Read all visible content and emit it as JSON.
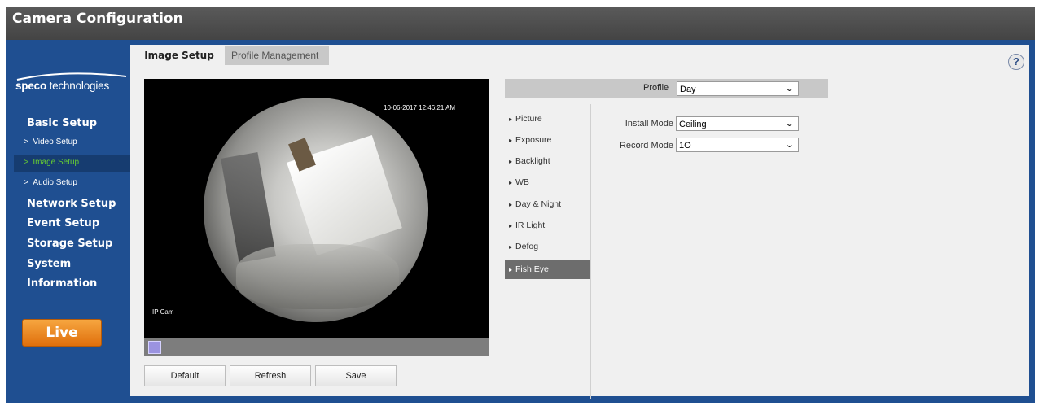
{
  "window": {
    "title": "Camera Configuration"
  },
  "logo": {
    "text_bold": "speco",
    "text_rest": " technologies"
  },
  "sidebar": {
    "sections": [
      {
        "label": "Basic Setup"
      },
      {
        "label": "Network Setup"
      },
      {
        "label": "Event Setup"
      },
      {
        "label": "Storage Setup"
      },
      {
        "label": "System"
      },
      {
        "label": "Information"
      }
    ],
    "sub_items": [
      {
        "label": "Video Setup"
      },
      {
        "label": "Image Setup"
      },
      {
        "label": "Audio Setup"
      }
    ],
    "sub_prefix": ">",
    "live_label": "Live"
  },
  "tabs": [
    {
      "label": "Image Setup"
    },
    {
      "label": "Profile Management"
    }
  ],
  "help": {
    "label": "?"
  },
  "video": {
    "timestamp": "10-06-2017 12:46:21 AM",
    "channel_name": "IP Cam"
  },
  "buttons": {
    "default": "Default",
    "refresh": "Refresh",
    "save": "Save"
  },
  "profile": {
    "label": "Profile",
    "value": "Day"
  },
  "menu": {
    "arrow": "▸",
    "items": [
      {
        "label": "Picture"
      },
      {
        "label": "Exposure"
      },
      {
        "label": "Backlight"
      },
      {
        "label": "WB"
      },
      {
        "label": "Day & Night"
      },
      {
        "label": "IR Light"
      },
      {
        "label": "Defog"
      },
      {
        "label": "Fish Eye"
      }
    ]
  },
  "fisheye": {
    "install_mode_label": "Install Mode",
    "install_mode_value": "Ceiling",
    "record_mode_label": "Record Mode",
    "record_mode_value": "1O"
  },
  "colors": {
    "frame_blue": "#1f4f91",
    "active_green": "#66cc33",
    "live_orange": "#f0861e",
    "menu_active": "#6d6d6d"
  }
}
